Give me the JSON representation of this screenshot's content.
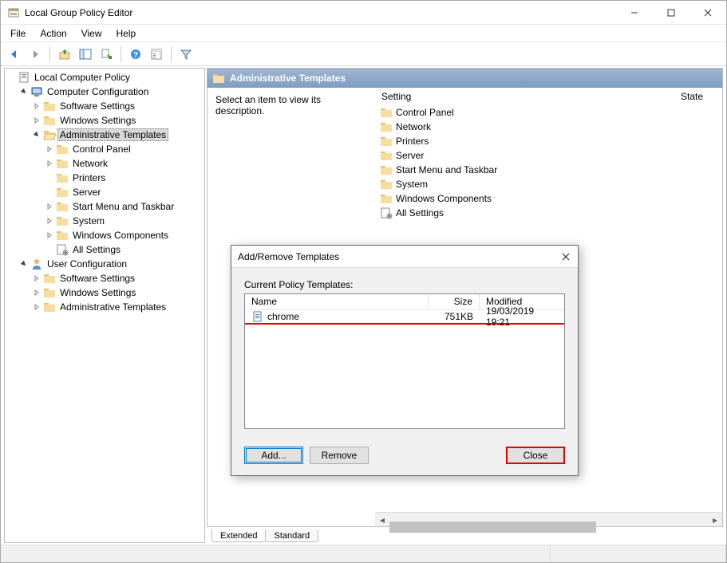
{
  "window": {
    "title": "Local Group Policy Editor"
  },
  "menu": [
    "File",
    "Action",
    "View",
    "Help"
  ],
  "tree": {
    "root": "Local Computer Policy",
    "comp_config": "Computer Configuration",
    "cc_software": "Software Settings",
    "cc_windows": "Windows Settings",
    "cc_admin": "Administrative Templates",
    "at_control_panel": "Control Panel",
    "at_network": "Network",
    "at_printers": "Printers",
    "at_server": "Server",
    "at_startmenu": "Start Menu and Taskbar",
    "at_system": "System",
    "at_wincomp": "Windows Components",
    "at_allsettings": "All Settings",
    "user_config": "User Configuration",
    "uc_software": "Software Settings",
    "uc_windows": "Windows Settings",
    "uc_admin": "Administrative Templates"
  },
  "detail": {
    "header": "Administrative Templates",
    "desc": "Select an item to view its description.",
    "col_setting": "Setting",
    "col_state": "State",
    "items": {
      "control_panel": "Control Panel",
      "network": "Network",
      "printers": "Printers",
      "server": "Server",
      "startmenu": "Start Menu and Taskbar",
      "system": "System",
      "wincomp": "Windows Components",
      "allsettings": "All Settings"
    }
  },
  "tabs": {
    "extended": "Extended",
    "standard": "Standard"
  },
  "dialog": {
    "title": "Add/Remove Templates",
    "label": "Current Policy Templates:",
    "col_name": "Name",
    "col_size": "Size",
    "col_modified": "Modified",
    "row": {
      "name": "chrome",
      "size": "751KB",
      "modified": "19/03/2019 19:21"
    },
    "btn_add": "Add...",
    "btn_remove": "Remove",
    "btn_close": "Close"
  }
}
